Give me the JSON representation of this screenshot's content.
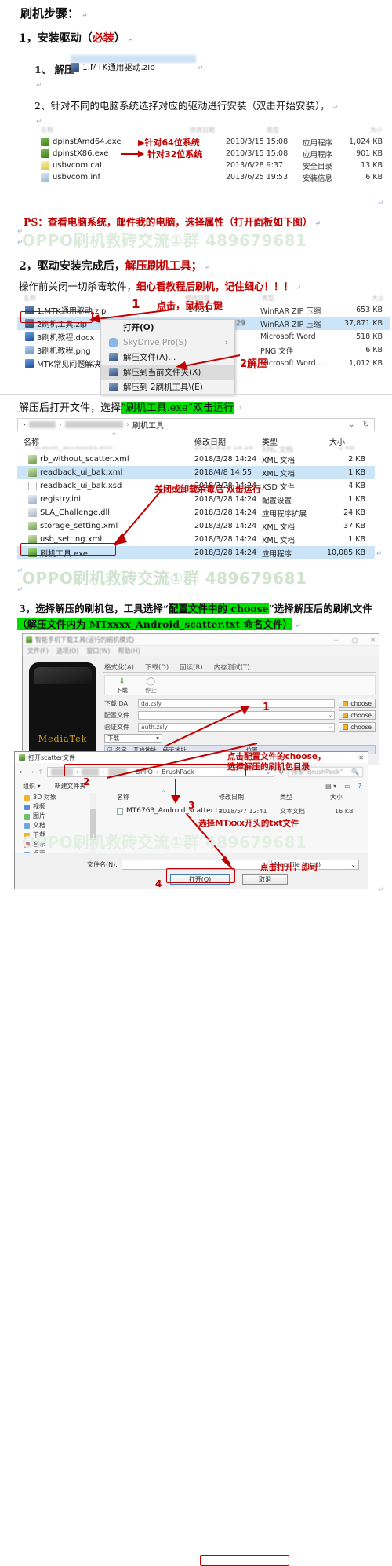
{
  "document": {
    "title": "刷机步骤：",
    "step1": {
      "heading_prefix": "1，安装驱动（",
      "heading_red": "必装",
      "heading_suffix": "）",
      "sub1_label": "1、 解压",
      "sub1_file": "1.MTK通用驱动.zip",
      "sub2": "2、针对不同的电脑系统选择对应的驱动进行安装（双击开始安装），",
      "ps_note": "PS：查看电脑系统，邮件我的电脑，选择属性（打开面板如下图）"
    },
    "step2": {
      "heading_prefix": "2，驱动安装完成后，",
      "heading_red": "解压刷机工具；",
      "line_prefix": "操作前关闭一切杀毒软件，",
      "line_red": "细心看教程后刷机，记住细心！！！"
    },
    "step3_intro": {
      "prefix": "解压后打开文件，选择",
      "highlight": "“刷机工具.exe”双击运行"
    },
    "step3": {
      "line1_a": "3，选择解压的刷机包，工具选择“",
      "line1_hl": "配置文件中的 choose",
      "line1_b": "”选择解压后的刷机文件",
      "line2_hl": "（解压文件内为 MTxxxx_Android_scatter.txt 命名文件）"
    },
    "watermark": "OPPO刷机救砖交流①群 489679681"
  },
  "explorer1": {
    "columns": [
      "名称",
      "修改日期",
      "类型",
      "大小"
    ],
    "rows": [
      {
        "name": "dpinstAmd64.exe",
        "date": "2010/3/15 15:08",
        "type": "应用程序",
        "size": "1,024 KB",
        "icon": "exe-icon",
        "annot": "▶针对64位系统"
      },
      {
        "name": "dpinstX86.exe",
        "date": "2010/3/15 15:08",
        "type": "应用程序",
        "size": "901 KB",
        "icon": "exe-icon",
        "annot": "针对32位系统"
      },
      {
        "name": "usbvcom.cat",
        "date": "2013/6/28 9:37",
        "type": "安全目录",
        "size": "13 KB",
        "icon": "cat-icon",
        "annot": ""
      },
      {
        "name": "usbvcom.inf",
        "date": "2013/6/25 19:53",
        "type": "安装信息",
        "size": "6 KB",
        "icon": "inf-icon",
        "annot": ""
      }
    ]
  },
  "explorer2": {
    "rows": [
      {
        "name": "1.MTK通用驱动.zip",
        "date": "14:51",
        "type": "WinRAR ZIP 压缩",
        "size": "653 KB",
        "icon": "zip-icon",
        "selected": false
      },
      {
        "name": "2刷机工具.zip",
        "date": "2018/7/9 17:29",
        "type": "WinRAR ZIP 压缩",
        "size": "37,871 KB",
        "icon": "zip-icon",
        "selected": true
      },
      {
        "name": "3刷机教程.docx",
        "date": "",
        "type": "Microsoft Word",
        "size": "518 KB",
        "icon": "doc-icon",
        "selected": false
      },
      {
        "name": "3刷机教程.png",
        "date": "",
        "type": "PNG 文件",
        "size": "6 KB",
        "icon": "png-icon",
        "selected": false
      },
      {
        "name": "MTK常见问题解决办",
        "date": "",
        "type": "Microsoft Word ...",
        "size": "1,012 KB",
        "icon": "doc-icon",
        "selected": false
      }
    ],
    "context_menu": [
      {
        "label": "打开(O)",
        "bold": true,
        "dim": false,
        "submenu": false,
        "icon": ""
      },
      {
        "label": "SkyDrive Pro(S)",
        "bold": false,
        "dim": true,
        "submenu": true,
        "icon": "cloud-icon"
      },
      {
        "label": "解压文件(A)...",
        "bold": false,
        "dim": false,
        "submenu": false,
        "icon": "rar-icon"
      },
      {
        "label": "解压到当前文件夹(X)",
        "bold": false,
        "dim": false,
        "submenu": false,
        "icon": "rar-icon"
      },
      {
        "label": "解压到 2刷机工具\\(E)",
        "bold": false,
        "dim": false,
        "submenu": false,
        "icon": "rar-icon"
      }
    ],
    "annotations": {
      "num1": "1",
      "click_text": "点击，鼠标右键",
      "num2_extract": "2解压"
    }
  },
  "explorer3": {
    "breadcrumb_tail": "刷机工具",
    "columns": [
      "名称",
      "修改日期",
      "类型",
      "大小"
    ],
    "rows": [
      {
        "name": "rb_without_scatter.xml",
        "date": "2018/3/28 14:24",
        "type": "XML 文档",
        "size": "2 KB",
        "icon": "xml-icon",
        "selected": false
      },
      {
        "name": "readback_ui_bak.xml",
        "date": "2018/4/8 14:55",
        "type": "XML 文档",
        "size": "1 KB",
        "icon": "xml-icon",
        "selected": true
      },
      {
        "name": "readback_ui_bak.xsd",
        "date": "2018/3/28 14:24",
        "type": "XSD 文件",
        "size": "4 KB",
        "icon": "xsd-icon",
        "selected": false
      },
      {
        "name": "registry.ini",
        "date": "2018/3/28 14:24",
        "type": "配置设置",
        "size": "1 KB",
        "icon": "ini-icon",
        "selected": false
      },
      {
        "name": "SLA_Challenge.dll",
        "date": "2018/3/28 14:24",
        "type": "应用程序扩展",
        "size": "24 KB",
        "icon": "dll-icon",
        "selected": false
      },
      {
        "name": "storage_setting.xml",
        "date": "2018/3/28 14:24",
        "type": "XML 文档",
        "size": "37 KB",
        "icon": "xml-icon",
        "selected": false
      },
      {
        "name": "usb_setting.xml",
        "date": "2018/3/28 14:24",
        "type": "XML 文档",
        "size": "1 KB",
        "icon": "xml-icon",
        "selected": false
      },
      {
        "name": "刷机工具.exe",
        "date": "2018/3/28 14:24",
        "type": "应用程序",
        "size": "10,085 KB",
        "icon": "app-icon",
        "selected": true
      }
    ],
    "annotation": "关闭或卸载杀毒后 双击运行"
  },
  "mtk_tool": {
    "title": "智能手机下载工具(运行的刷机模式)",
    "menus": [
      "文件(F)",
      "选项(O)",
      "窗口(W)",
      "帮助(H)"
    ],
    "tabs": [
      "格式化(A)",
      "下载(D)",
      "回读(R)",
      "内存测试(T)"
    ],
    "toolbar": [
      {
        "label": "下载",
        "icon": "download-arrow-icon"
      },
      {
        "label": "停止",
        "icon": "stop-circle-icon"
      }
    ],
    "phone_brand": "MediaTek",
    "fields": [
      {
        "label": "下载 DA",
        "value": "da.zsly",
        "button": "choose",
        "has_dropdown": false
      },
      {
        "label": "配置文件",
        "value": "",
        "button": "choose",
        "has_dropdown": true
      },
      {
        "label": "验证文件",
        "value": "auth.zsly",
        "button": "choose",
        "has_dropdown": true
      }
    ],
    "mode_select": "下载",
    "table_columns": [
      "名字",
      "开始地址",
      "结束地址",
      "位置"
    ],
    "annotations": {
      "num1": "1",
      "text": "点击配置文件的choose，"
    }
  },
  "open_dialog": {
    "title": "打开scatter文件",
    "breadcrumb": [
      "OPPO",
      "BrushPack"
    ],
    "search_placeholder": "搜索“BrushPack”",
    "toolbar": [
      "组织 ▾",
      "新建文件夹"
    ],
    "sidebar": [
      {
        "label": "3D 对象",
        "color": "#f0b429"
      },
      {
        "label": "视频",
        "color": "#5b8dd6"
      },
      {
        "label": "图片",
        "color": "#6fbf73"
      },
      {
        "label": "文档",
        "color": "#6fa8dc"
      },
      {
        "label": "下载",
        "color": "#f0b429"
      },
      {
        "label": "音乐",
        "color": "#c27ba0"
      },
      {
        "label": "桌面",
        "color": "#6fa8dc"
      }
    ],
    "columns": [
      "名称",
      "修改日期",
      "类型",
      "大小"
    ],
    "rows": [
      {
        "name": "MT6763_Android_scatter.txt",
        "date": "2018/5/7 12:41",
        "type": "文本文档",
        "size": "16 KB",
        "icon": "txt-icon"
      }
    ],
    "filename_label": "文件名(N):",
    "filename_value": "",
    "filter": "Map File (*.txt)",
    "open_button": "打开(O)",
    "cancel_button": "取消",
    "annotations": {
      "num2": "2",
      "choose_note": "点击配置文件的choose，",
      "dir_note": "选择解压的刷机包目录",
      "num3": "3",
      "txt_note": "选择MTxxx开头的txt文件",
      "num4": "4",
      "open_note": "点击打开，即可"
    }
  },
  "colors": {
    "red_annotation": "#c00000",
    "green_highlight": "#00e000",
    "watermark": "#dcebdc",
    "selection_blue": "#cce4f7"
  }
}
